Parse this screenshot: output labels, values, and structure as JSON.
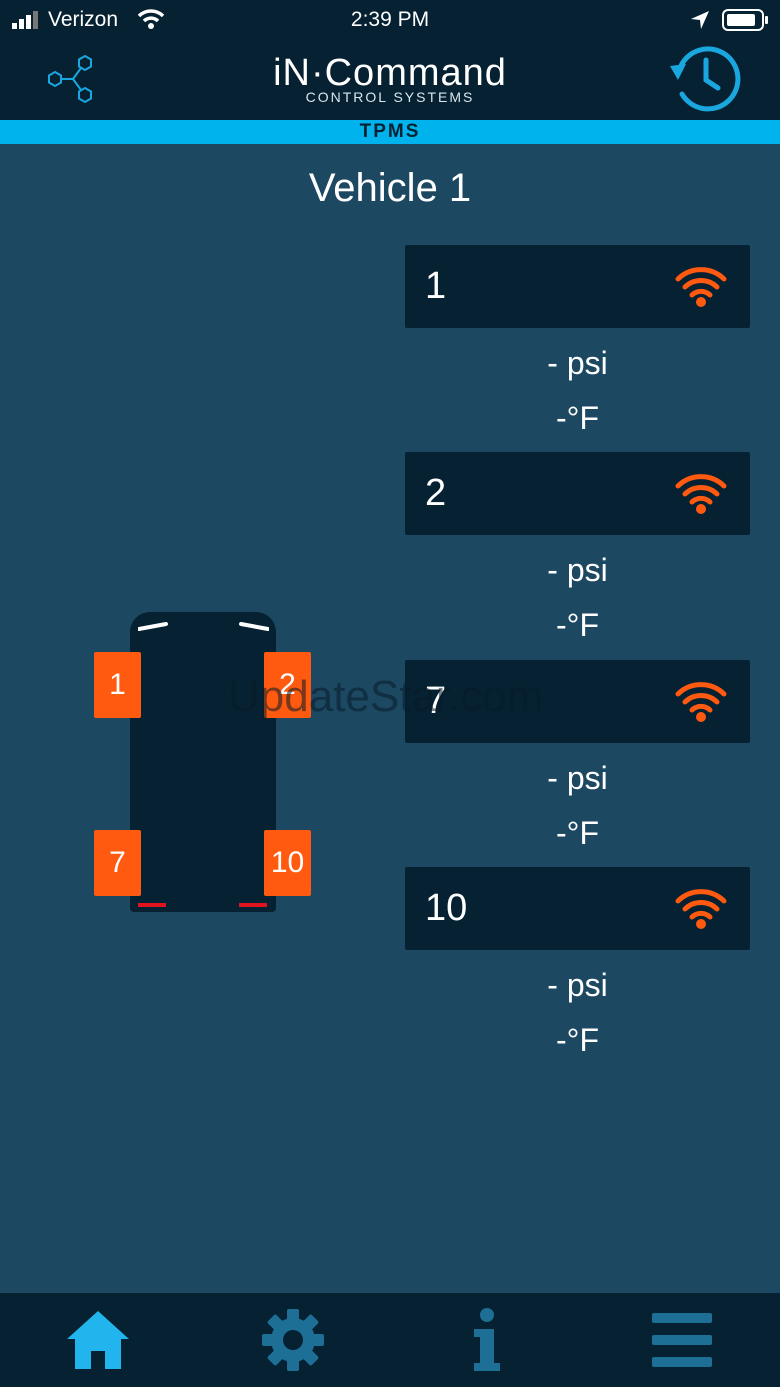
{
  "status_bar": {
    "carrier": "Verizon",
    "time": "2:39 PM"
  },
  "header": {
    "brand": "iN·Command",
    "brand_sub": "CONTROL SYSTEMS",
    "section": "TPMS"
  },
  "vehicle": {
    "title": "Vehicle 1"
  },
  "sensors": [
    {
      "id": "1",
      "pressure": "- psi",
      "temperature": "-°F"
    },
    {
      "id": "2",
      "pressure": "- psi",
      "temperature": "-°F"
    },
    {
      "id": "7",
      "pressure": "- psi",
      "temperature": "-°F"
    },
    {
      "id": "10",
      "pressure": "- psi",
      "temperature": "-°F"
    }
  ],
  "tires": {
    "front_left": "1",
    "front_right": "2",
    "rear_left": "7",
    "rear_right": "10"
  },
  "watermark": "UpdateStar.com",
  "nav": [
    "home-icon",
    "gear-icon",
    "info-icon",
    "menu-icon"
  ],
  "colors": {
    "accent": "#00b3ec",
    "alert": "#ff5a0f",
    "panel": "#062131",
    "background": "#1c4862"
  }
}
